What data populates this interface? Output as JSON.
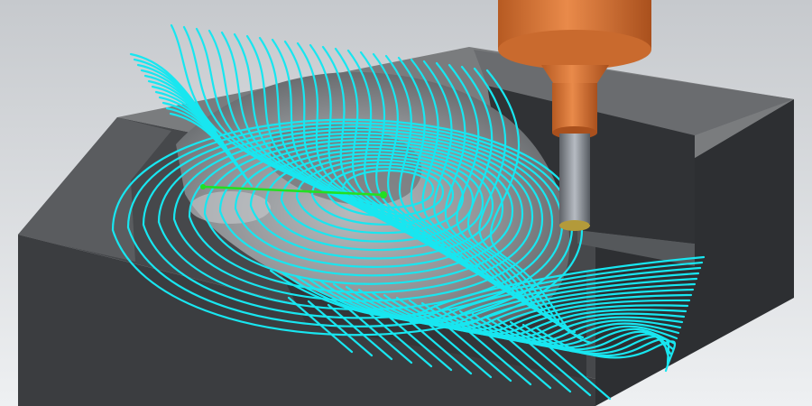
{
  "scene": {
    "subject": "cnc-machining-toolpath-render",
    "colors": {
      "background_top": "#c9ccd0",
      "background_bottom": "#eceef0",
      "stock_top": "#7a7c7e",
      "stock_front": "#3b3d40",
      "stock_side": "#2d2f32",
      "cavity": "#8d9093",
      "toolpath": "#18e6f0",
      "link_path": "#22e022",
      "tool_holder": "#e07a3a",
      "tool_holder_dark": "#b65a22",
      "cutter": "#8a8f96"
    },
    "elements": [
      "workpiece-block",
      "machined-cavity",
      "cyan-toolpath-lines",
      "green-link-move",
      "spindle-tool-holder",
      "cutter"
    ]
  }
}
